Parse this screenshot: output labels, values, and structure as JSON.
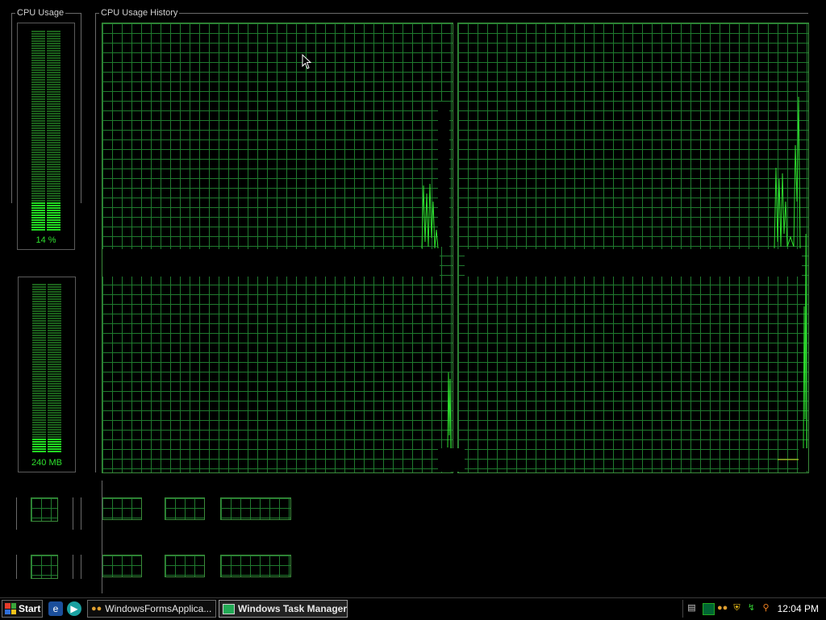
{
  "cpu_meter": {
    "title": "CPU Usage",
    "value": "14 %",
    "level": 0.14
  },
  "history": {
    "title": "CPU Usage History"
  },
  "mem_meter": {
    "value": "240 MB",
    "level": 0.08
  },
  "colors": {
    "grid": "#1f7a2e",
    "trace": "#2ee02e",
    "meter_on": "#22dd22",
    "meter_off": "#1b5f1b"
  },
  "taskbar": {
    "start_label": "Start",
    "quick_launch": [
      "ie-icon",
      "media-player-icon"
    ],
    "tasks": [
      {
        "label": "WindowsFormsApplica...",
        "icon": "app-icon",
        "active": false
      },
      {
        "label": "Windows Task Manager",
        "icon": "task-manager-icon",
        "active": true
      }
    ],
    "tray_icons": [
      "keyboard-icon",
      "network-icon",
      "messenger-icon",
      "security-shield-icon",
      "safely-remove-icon",
      "search-icon"
    ],
    "clock": "12:04 PM"
  }
}
